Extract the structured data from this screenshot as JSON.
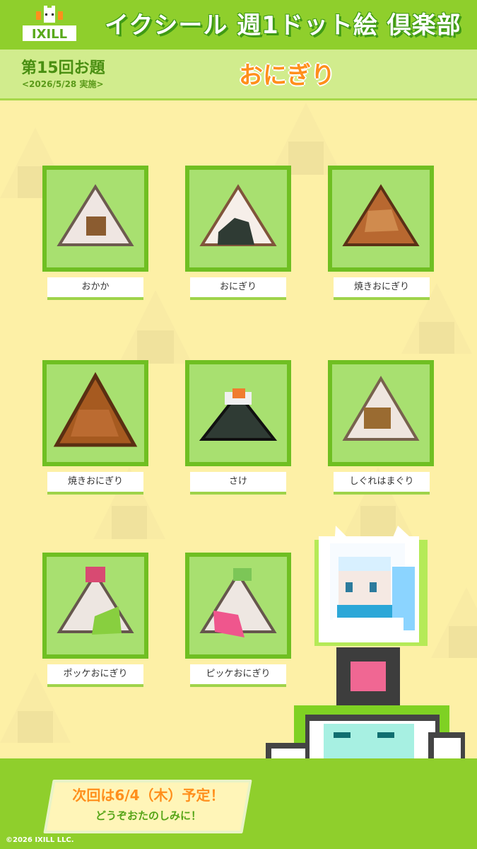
{
  "header": {
    "logo_text": "IXILL",
    "title": "イクシール 週1ドット絵 倶楽部"
  },
  "subheader": {
    "episode": "第15回お題",
    "date": "<2026/5/28 実施>",
    "topic": "おにぎり"
  },
  "items": [
    {
      "label": "おかか"
    },
    {
      "label": "おにぎり"
    },
    {
      "label": "焼きおにぎり"
    },
    {
      "label": "焼きおにぎり"
    },
    {
      "label": "さけ"
    },
    {
      "label": "しぐれはまぐり"
    },
    {
      "label": "ポッケおにぎり"
    },
    {
      "label": "ピッケおにぎり"
    }
  ],
  "footer": {
    "next_main": "次回は6/4（木）予定！",
    "next_sub": "どうぞおたのしみに！",
    "copyright": "©2026 IXILL LLC."
  },
  "colors": {
    "green": "#8fcf2c",
    "dark_green": "#3f9a15",
    "cream": "#fdf0a6",
    "orange": "#ff8f1c",
    "tile_green": "#a8e070"
  }
}
